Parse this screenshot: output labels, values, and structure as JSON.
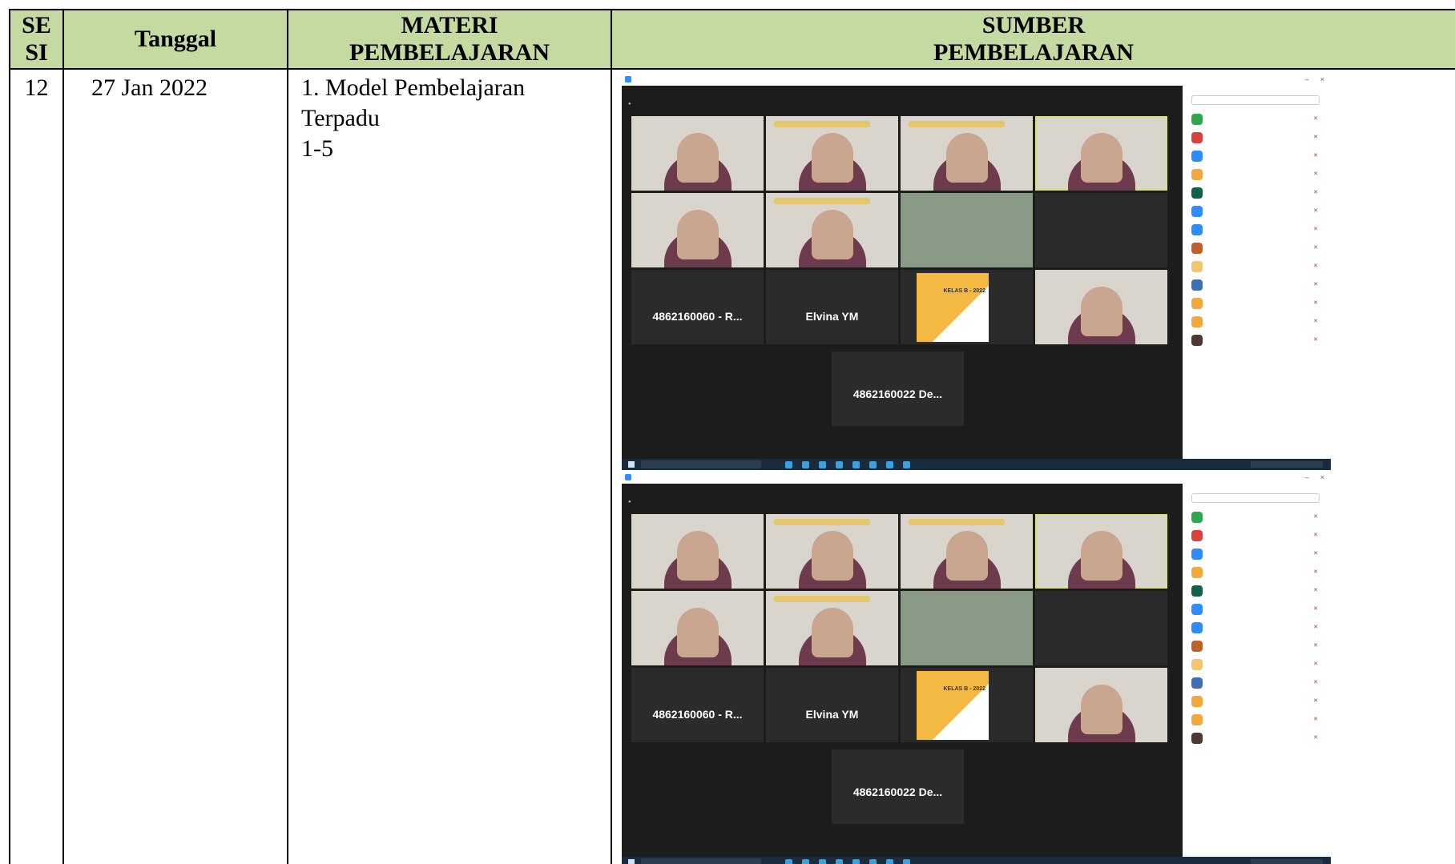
{
  "table": {
    "headers": {
      "sesi_line1": "SE",
      "sesi_line2": "SI",
      "tanggal": "Tanggal",
      "materi_line1": "MATERI",
      "materi_line2": "PEMBELAJARAN",
      "sumber_line1": "SUMBER",
      "sumber_line2": "PEMBELAJARAN"
    },
    "row": {
      "sesi": "12",
      "tanggal": "27 Jan 2022",
      "materi_line1": "1. Model Pembelajaran Terpadu",
      "materi_line2": "1-5"
    }
  },
  "zoom_screenshot": {
    "tile_names": {
      "name_a": "4862160060 - R...",
      "name_b": "Elvina YM",
      "name_c": "4862160022 De..."
    },
    "poster_text": "KELAS B - 2022",
    "participants_count_rows": 13
  },
  "colors": {
    "header_bg": "#c5daa0",
    "zoom_stage": "#1c1c1c",
    "taskbar": "#1a2b3d"
  }
}
